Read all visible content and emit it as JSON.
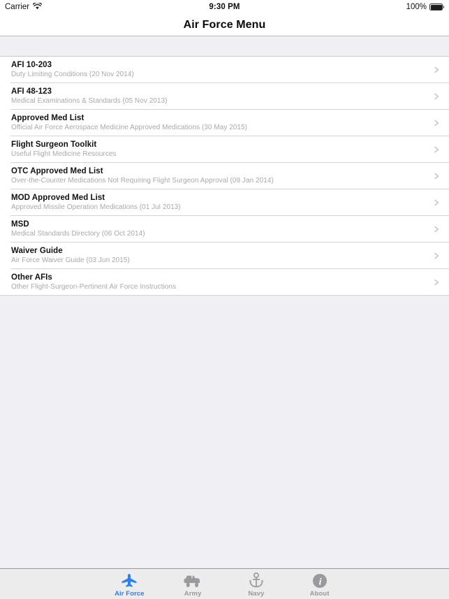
{
  "status_bar": {
    "carrier": "Carrier",
    "wifi_icon": "wifi-icon",
    "time": "9:30 PM",
    "battery_percent": "100%",
    "battery_icon": "battery-full-icon"
  },
  "nav_bar": {
    "title": "Air Force Menu"
  },
  "menu": {
    "disclosure_icon": "chevron-right-icon",
    "items": [
      {
        "title": "AFI 10-203",
        "subtitle": "Duty Limiting Conditions (20 Nov 2014)"
      },
      {
        "title": "AFI 48-123",
        "subtitle": "Medical Examinations & Standards (05 Nov 2013)"
      },
      {
        "title": "Approved Med List",
        "subtitle": "Official Air Force Aerospace Medicine Approved Medications (30 May 2015)"
      },
      {
        "title": "Flight Surgeon Toolkit",
        "subtitle": "Useful Flight Medicine Resources"
      },
      {
        "title": "OTC Approved Med List",
        "subtitle": "Over-the-Counter Medications Not Requiring Flight Surgeon Approval (09 Jan 2014)"
      },
      {
        "title": "MOD Approved Med List",
        "subtitle": "Approved Missile Operation Medications (01 Jul 2013)"
      },
      {
        "title": "MSD",
        "subtitle": "Medical Standards Directory (06 Oct 2014)"
      },
      {
        "title": "Waiver Guide",
        "subtitle": "Air Force Waiver Guide (03 Jun 2015)"
      },
      {
        "title": "Other AFIs",
        "subtitle": "Other Flight-Surgeon-Pertinent Air Force Instructions"
      }
    ]
  },
  "tab_bar": {
    "selected_color": "#2f7ff4",
    "inactive_color": "#9a9a9e",
    "tabs": [
      {
        "label": "Air Force",
        "icon": "airplane-icon",
        "selected": true
      },
      {
        "label": "Army",
        "icon": "jeep-icon",
        "selected": false
      },
      {
        "label": "Navy",
        "icon": "anchor-icon",
        "selected": false
      },
      {
        "label": "About",
        "icon": "info-circle-icon",
        "selected": false
      }
    ]
  }
}
